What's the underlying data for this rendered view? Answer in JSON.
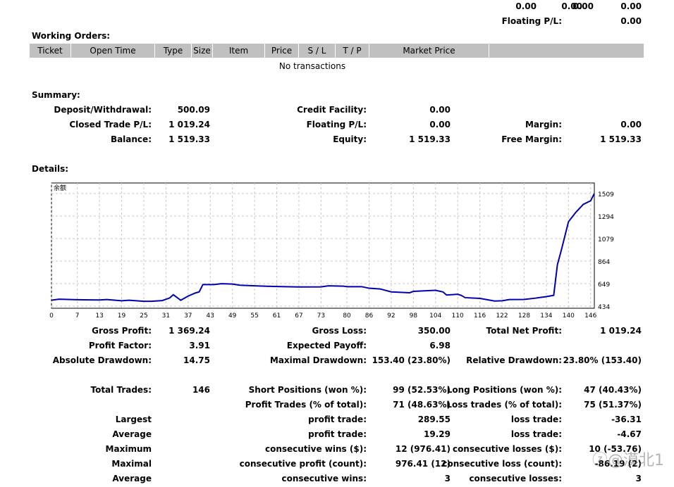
{
  "top": {
    "values": [
      "0.00",
      "0.00",
      "0.00",
      "0.00"
    ],
    "floating_label": "Floating P/L:",
    "floating_value": "0.00"
  },
  "working_orders": {
    "title": "Working Orders:",
    "columns": [
      "Ticket",
      "Open Time",
      "Type",
      "Size",
      "Item",
      "Price",
      "S / L",
      "T / P",
      "Market Price",
      ""
    ],
    "empty": "No transactions"
  },
  "summary": {
    "title": "Summary:",
    "rows": [
      [
        [
          "Deposit/Withdrawal:",
          "500.09"
        ],
        [
          "Credit Facility:",
          "0.00"
        ],
        [
          "",
          ""
        ]
      ],
      [
        [
          "Closed Trade P/L:",
          "1 019.24"
        ],
        [
          "Floating P/L:",
          "0.00"
        ],
        [
          "Margin:",
          "0.00"
        ]
      ],
      [
        [
          "Balance:",
          "1 519.33"
        ],
        [
          "Equity:",
          "1 519.33"
        ],
        [
          "Free Margin:",
          "1 519.33"
        ]
      ]
    ]
  },
  "details": {
    "title": "Details:",
    "rows": [
      [
        [
          "Gross Profit:",
          "1 369.24"
        ],
        [
          "Gross Loss:",
          "350.00"
        ],
        [
          "Total Net Profit:",
          "1 019.24"
        ]
      ],
      [
        [
          "Profit Factor:",
          "3.91"
        ],
        [
          "Expected Payoff:",
          "6.98"
        ],
        [
          "",
          ""
        ]
      ],
      [
        [
          "Absolute Drawdown:",
          "14.75"
        ],
        [
          "Maximal Drawdown:",
          "153.40 (23.80%)"
        ],
        [
          "Relative Drawdown:",
          "23.80% (153.40)"
        ]
      ],
      [
        [
          "Total Trades:",
          "146"
        ],
        [
          "Short Positions (won %):",
          "99 (52.53%)"
        ],
        [
          "Long Positions (won %):",
          "47 (40.43%)"
        ]
      ],
      [
        [
          "",
          ""
        ],
        [
          "Profit Trades (% of total):",
          "71 (48.63%)"
        ],
        [
          "Loss trades (% of total):",
          "75 (51.37%)"
        ]
      ],
      [
        [
          "Largest",
          ""
        ],
        [
          "profit trade:",
          "289.55"
        ],
        [
          "loss trade:",
          "-36.31"
        ]
      ],
      [
        [
          "Average",
          ""
        ],
        [
          "profit trade:",
          "19.29"
        ],
        [
          "loss trade:",
          "-4.67"
        ]
      ],
      [
        [
          "Maximum",
          ""
        ],
        [
          "consecutive wins ($):",
          "12 (976.41)"
        ],
        [
          "consecutive losses ($):",
          "10 (-53.76)"
        ]
      ],
      [
        [
          "Maximal",
          ""
        ],
        [
          "consecutive profit (count):",
          "976.41 (12)"
        ],
        [
          "consecutive loss (count):",
          "-86.19 (2)"
        ]
      ],
      [
        [
          "Average",
          ""
        ],
        [
          "consecutive wins:",
          "3"
        ],
        [
          "consecutive losses:",
          "3"
        ]
      ]
    ]
  },
  "watermark": "知乎 @漠北1",
  "chart_data": {
    "type": "line",
    "title": "余额",
    "line_color": "#0000b0",
    "grid": true,
    "xticks": [
      0,
      7,
      13,
      19,
      25,
      31,
      37,
      43,
      49,
      55,
      61,
      67,
      73,
      80,
      86,
      92,
      98,
      104,
      110,
      116,
      122,
      128,
      134,
      140,
      146
    ],
    "yticks": [
      434,
      649,
      864,
      1079,
      1294,
      1509
    ],
    "xlim": [
      0,
      147
    ],
    "ylim": [
      434,
      1509
    ],
    "series": [
      {
        "x": [
          0,
          2,
          7,
          13,
          15,
          19,
          21,
          25,
          27,
          30,
          32,
          33,
          35,
          37,
          39,
          40,
          41,
          44,
          46,
          49,
          51,
          55,
          60,
          67,
          73,
          75,
          79,
          80,
          84,
          86,
          89,
          92,
          97,
          98,
          104,
          106,
          107,
          110,
          111,
          112,
          116,
          120,
          122,
          124,
          128,
          131,
          134,
          136,
          137,
          138,
          140,
          142,
          144,
          146,
          147
        ],
        "y": [
          490,
          500,
          495,
          493,
          497,
          485,
          490,
          480,
          480,
          487,
          512,
          543,
          490,
          530,
          560,
          570,
          640,
          640,
          648,
          645,
          634,
          628,
          622,
          617,
          618,
          628,
          625,
          620,
          620,
          605,
          598,
          570,
          562,
          575,
          585,
          570,
          540,
          547,
          536,
          515,
          508,
          483,
          485,
          497,
          498,
          510,
          525,
          537,
          830,
          960,
          1240,
          1330,
          1405,
          1440,
          1509
        ]
      }
    ]
  }
}
